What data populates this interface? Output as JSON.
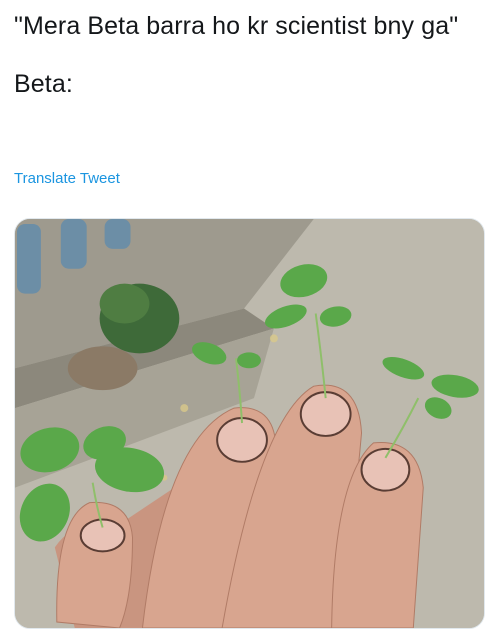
{
  "tweet": {
    "line1": "\"Mera Beta barra ho kr scientist bny ga\"",
    "line2": "Beta:"
  },
  "translate_label": "Translate Tweet",
  "photo": {
    "icon": "hand-with-sprouts-photo",
    "colors": {
      "ground": "#b9b6ab",
      "skin": "#d8a58f",
      "nail": "#e8c2b6",
      "leaf": "#5aa84a",
      "pillar": "#6c8ea6"
    }
  }
}
